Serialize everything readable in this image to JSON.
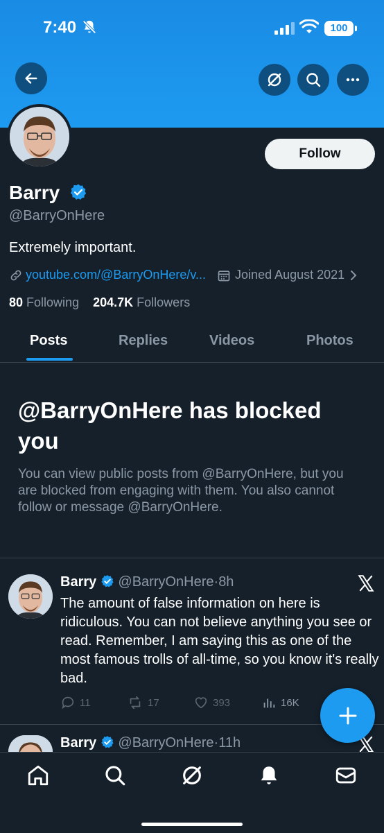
{
  "status_bar": {
    "time": "7:40",
    "battery": "100"
  },
  "header_icons": [
    "back-arrow-icon",
    "grok-icon",
    "search-icon",
    "more-icon"
  ],
  "profile": {
    "name": "Barry",
    "handle": "@BarryOnHere",
    "bio": "Extremely important.",
    "link": "youtube.com/@BarryOnHere/v...",
    "joined": "Joined August 2021",
    "following_count": "80",
    "following_label": "Following",
    "followers_count": "204.7K",
    "followers_label": "Followers",
    "follow_label": "Follow"
  },
  "tabs": [
    {
      "label": "Posts",
      "active": true
    },
    {
      "label": "Replies",
      "active": false
    },
    {
      "label": "Videos",
      "active": false
    },
    {
      "label": "Photos",
      "active": false
    }
  ],
  "blocked": {
    "title": "@BarryOnHere has blocked you",
    "text": "You can view public posts from @BarryOnHere, but you are blocked from engaging with them. You also cannot follow or message @BarryOnHere."
  },
  "posts": [
    {
      "name": "Barry",
      "handle": "@BarryOnHere",
      "time": "8h",
      "text": "The amount of false information on here is ridiculous. You can not believe anything you see or read. Remember, I am saying this as one of the most famous trolls of all-time, so you know it's really bad.",
      "replies": "11",
      "reposts": "17",
      "likes": "393",
      "views": "16K"
    },
    {
      "name": "Barry",
      "handle": "@BarryOnHere",
      "time": "11h"
    }
  ],
  "colors": {
    "accent": "#1d9bf0",
    "background": "#15202b",
    "muted": "#8b98a5"
  }
}
